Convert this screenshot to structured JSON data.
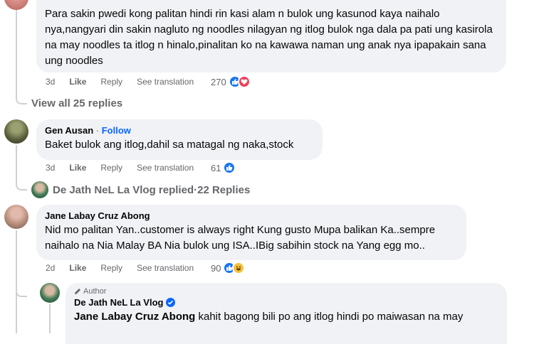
{
  "comment1": {
    "text": "Para sakin pwedi kong palitan hindi rin kasi alam n bulok ung kasunod kaya naihalo nya,nangyari din sakin nagluto ng noodles nilagyan ng itlog bulok nga dala pa pati ung kasirola na may noodles ta itlog n hinalo,pinalitan ko na kawawa naman ung anak nya ipapakain sana ung noodles",
    "time": "3d",
    "like_label": "Like",
    "reply_label": "Reply",
    "translate_label": "See translation",
    "reaction_count": "270",
    "view_replies": "View all 25 replies"
  },
  "comment2": {
    "author": "Gen Ausan",
    "follow_sep": " · ",
    "follow_label": "Follow",
    "text": "Baket bulok ang itlog,dahil sa matagal ng naka,stock",
    "time": "3d",
    "like_label": "Like",
    "reply_label": "Reply",
    "translate_label": "See translation",
    "reaction_count": "61",
    "replied_by": "De Jath NeL La Vlog replied",
    "replied_sep": " · ",
    "reply_count": "22 Replies"
  },
  "comment3": {
    "author": "Jane Labay Cruz Abong",
    "text": "Nid mo palitan Yan..customer is always right Kung gusto Mupa balikan Ka..sempre naihalo na Nia Malay BA Nia bulok ung ISA..IBig sabihin stock na Yang egg mo..",
    "time": "2d",
    "like_label": "Like",
    "reply_label": "Reply",
    "translate_label": "See translation",
    "reaction_count": "90"
  },
  "reply1": {
    "badge": "Author",
    "author": "De Jath NeL La Vlog",
    "mention": "Jane Labay Cruz Abong",
    "text": " kahit bagong bili po ang itlog hindi po maiwasan na may"
  },
  "colors": {
    "bubble": "#f0f2f5",
    "meta_text": "#65676b",
    "like_blue": "#1877f2",
    "love_red": "#f33e58",
    "haha_yellow": "#f7c13e",
    "follow_blue": "#0866ff",
    "verified_blue": "#0866ff"
  }
}
